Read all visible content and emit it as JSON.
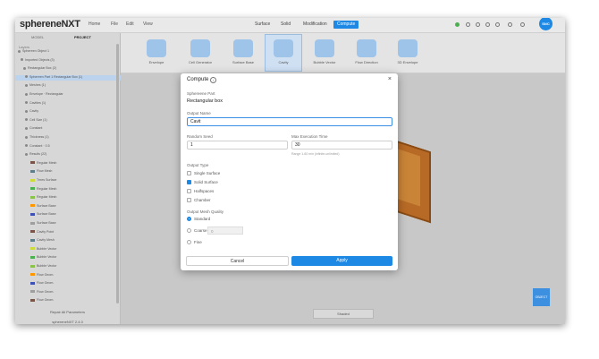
{
  "app": {
    "logo": "sphereneNXT",
    "menu": [
      "Home",
      "File",
      "Edit",
      "View"
    ]
  },
  "ribbon_tabs": [
    "Surface",
    "Solid",
    "Modification",
    "Compute"
  ],
  "active_tab": "Compute",
  "ribbon_buttons": [
    "Envelope",
    "Cell Generator",
    "Surface Base",
    "Cavity",
    "Bubble Vector",
    "Flow Direction",
    "3D Envelope"
  ],
  "selected_ribbon_button": "Cavity",
  "user": {
    "initials": "SNC"
  },
  "left_panel": {
    "tabs": [
      "MODEL",
      "PROJECT"
    ],
    "layers_label": "Layers",
    "rows": [
      "Sphereen Object 1",
      "Imported Objects (3)",
      "Rectangular Box (2)",
      "Sphereen Part 1 Rectangular Box (1)",
      "Meshes (1)",
      "Envelope · Rectangular",
      "Cavities (1)",
      "Cavity",
      "Cell Size (1)",
      "Constant",
      "Thickness (1)",
      "Constant · 0.5",
      "Results (22)",
      "Regular Mesh",
      "Flow Mesh",
      "Tmes Surface",
      "Regular Mesh",
      "Regular Mesh",
      "Surface Base",
      "Surface Base",
      "Surface Base",
      "Cavity Point",
      "Cavity Mesh",
      "Bubble Vector",
      "Bubble Vector",
      "Bubble Vector",
      "Flow Geom.",
      "Flow Geom.",
      "Flow Geom.",
      "Flow Geom."
    ],
    "repair_label": "Repair All Parameters",
    "version": "sphereneNXT 2.4.0"
  },
  "dialog": {
    "title": "Compute",
    "close": "×",
    "sphereene_part_label": "Sphereene Part",
    "sphereene_part_value": "Rectangular box",
    "output_name_label": "Output Name",
    "output_name_value": "Cavit",
    "random_seed_label": "Random Seed",
    "random_seed_value": "1",
    "max_exec_label": "Max Execution Time",
    "max_exec_value": "30",
    "max_exec_hint": "Range 1-60 min (infinite-unlimited)",
    "output_type_label": "Output Type",
    "output_types": [
      {
        "label": "Single Surface",
        "checked": false
      },
      {
        "label": "Solid Surface",
        "checked": true
      },
      {
        "label": "Halfspaces",
        "checked": false
      },
      {
        "label": "Chamber",
        "checked": false
      }
    ],
    "mesh_quality_label": "Output Mesh Quality",
    "mesh_qualities": [
      {
        "label": "Standard",
        "selected": true
      },
      {
        "label": "Coarse",
        "selected": false
      },
      {
        "label": "Fine",
        "selected": false
      }
    ],
    "coarse_value": "0",
    "cancel_label": "Cancel",
    "apply_label": "Apply"
  },
  "bottom_control": "Shaded",
  "viewcube_label": "OBJECT",
  "colors": {
    "accent": "#1e88e5",
    "box": "#b76a26"
  }
}
